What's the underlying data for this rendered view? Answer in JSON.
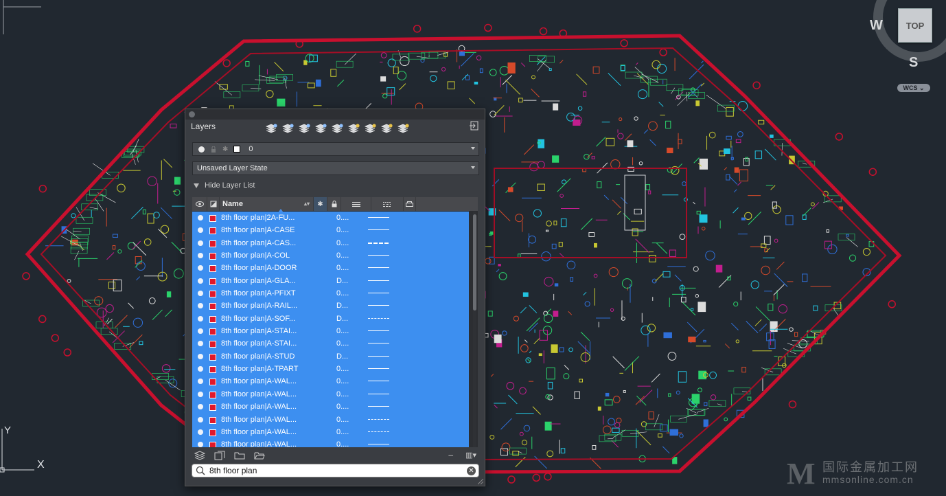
{
  "colors": {
    "canvas_bg": "#212830",
    "boundary": "#c8102e",
    "selection": "#3d8ff0",
    "layer_color_swatch": "#e0182b"
  },
  "viewcube": {
    "face_label": "TOP",
    "west_label": "W",
    "south_label": "S",
    "wcs_label": "WCS"
  },
  "ucs": {
    "y_label": "Y",
    "x_label": "X"
  },
  "layers_panel": {
    "title": "Layers",
    "toolbar_icons": [
      "new-layer-icon",
      "new-layer-vp-frozen-icon",
      "delete-layer-icon",
      "set-current-icon",
      "layer-merge-icon",
      "isolate-layer-icon",
      "unisolate-layer-icon",
      "lock-layer-icon",
      "unlock-layer-icon"
    ],
    "current_layer": "0",
    "layer_state": "Unsaved Layer State",
    "hide_list_label": "Hide Layer List",
    "columns": {
      "name": "Name"
    },
    "layers": [
      {
        "name": "8th floor plan|2A-FU...",
        "lineweight": "0....",
        "linetype": "solid"
      },
      {
        "name": "8th floor plan|A-CASE",
        "lineweight": "0....",
        "linetype": "solid"
      },
      {
        "name": "8th floor plan|A-CAS...",
        "lineweight": "0....",
        "linetype": "dashdot"
      },
      {
        "name": "8th floor plan|A-COL",
        "lineweight": "0....",
        "linetype": "solid"
      },
      {
        "name": "8th floor plan|A-DOOR",
        "lineweight": "0....",
        "linetype": "solid"
      },
      {
        "name": "8th floor plan|A-GLA...",
        "lineweight": "D...",
        "linetype": "solid"
      },
      {
        "name": "8th floor plan|A-PFIXT",
        "lineweight": "0....",
        "linetype": "solid"
      },
      {
        "name": "8th floor plan|A-RAIL...",
        "lineweight": "D...",
        "linetype": "solid"
      },
      {
        "name": "8th floor plan|A-SOF...",
        "lineweight": "D...",
        "linetype": "dashed"
      },
      {
        "name": "8th floor plan|A-STAI...",
        "lineweight": "0....",
        "linetype": "solid"
      },
      {
        "name": "8th floor plan|A-STAI...",
        "lineweight": "0....",
        "linetype": "solid"
      },
      {
        "name": "8th floor plan|A-STUD",
        "lineweight": "D...",
        "linetype": "solid"
      },
      {
        "name": "8th floor plan|A-TPART",
        "lineweight": "0....",
        "linetype": "solid"
      },
      {
        "name": "8th floor plan|A-WAL...",
        "lineweight": "0....",
        "linetype": "solid"
      },
      {
        "name": "8th floor plan|A-WAL...",
        "lineweight": "0....",
        "linetype": "solid"
      },
      {
        "name": "8th floor plan|A-WAL...",
        "lineweight": "0....",
        "linetype": "solid"
      },
      {
        "name": "8th floor plan|A-WAL...",
        "lineweight": "0....",
        "linetype": "dashed"
      },
      {
        "name": "8th floor plan|A-WAL...",
        "lineweight": "0....",
        "linetype": "dashed"
      },
      {
        "name": "8th floor plan|A-WAL...",
        "lineweight": "0....",
        "linetype": "solid"
      }
    ],
    "search_value": "8th floor plan"
  },
  "watermark": {
    "logo": "M",
    "chinese": "国际金属加工网",
    "url": "mmsonline.com.cn"
  }
}
